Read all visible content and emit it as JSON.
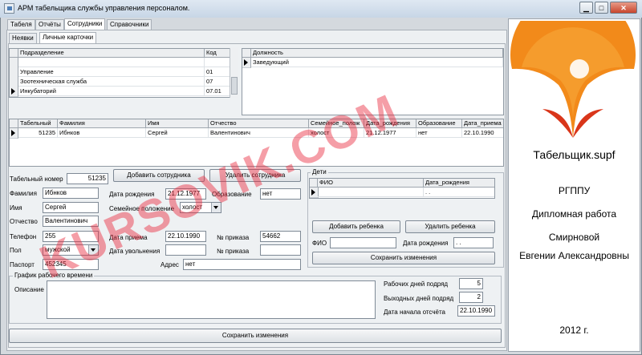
{
  "window": {
    "title": "АРМ табельщика службы управления персоналом.",
    "btn_min": "▁",
    "btn_max": "□",
    "btn_close": "✕"
  },
  "tabs": [
    "Табеля",
    "Отчёты",
    "Сотрудники",
    "Справочники"
  ],
  "subtabs": [
    "Неявки",
    "Личные карточки"
  ],
  "departments": {
    "headers": [
      "Подразделение",
      "Код"
    ],
    "rows": [
      {
        "name": "",
        "code": ""
      },
      {
        "name": "Управление",
        "code": "01"
      },
      {
        "name": "Зоотехническая служба",
        "code": "07"
      },
      {
        "name": "Инкубаторий",
        "code": "07.01"
      }
    ]
  },
  "positions": {
    "header": "Должность",
    "rows": [
      "Заведующий"
    ]
  },
  "employees": {
    "headers": [
      "Табельный",
      "Фамилия",
      "Имя",
      "Отчество",
      "Семейное_полож",
      "Дата_рождения",
      "Образование",
      "Дата_приема"
    ],
    "rows": [
      [
        "51235",
        "Ибнков",
        "Сергей",
        "Валентинович",
        "холост",
        "21.12.1977",
        "нет",
        "22.10.1990"
      ]
    ]
  },
  "form": {
    "tab_number_label": "Табельный номер",
    "tab_number": "51235",
    "add_employee": "Добавить сотрудника",
    "delete_employee": "Удалить сотрудника",
    "surname_label": "Фамилия",
    "surname": "Ибнков",
    "name_label": "Имя",
    "name": "Сергей",
    "patronymic_label": "Отчество",
    "patronymic": "Валентинович",
    "phone_label": "Телефон",
    "phone": "255",
    "gender_label": "Пол",
    "gender": "мужской",
    "passport_label": "Паспорт",
    "passport": "452345",
    "birth_label": "Дата рождения",
    "birth": "21.12.1977",
    "education_label": "Образование",
    "education": "нет",
    "marital_label": "Семейное положение",
    "marital": "холост",
    "hire_label": "Дата приема",
    "hire": "22.10.1990",
    "order_label": "№ приказа",
    "order": "54662",
    "dismiss_label": "Дата увольнения",
    "dismiss": "",
    "order2_label": "№ приказа",
    "order2": "",
    "address_label": "Адрес",
    "address": "нет"
  },
  "children": {
    "title": "Дети",
    "headers": [
      "ФИО",
      "Дата_рождения"
    ],
    "row": [
      "",
      ". ."
    ],
    "add": "Добавить ребенка",
    "delete": "Удалить ребенка",
    "fio_label": "ФИО",
    "fio": "",
    "birth_label": "Дата рождения",
    "birth": ". .",
    "save": "Сохранить изменения"
  },
  "schedule": {
    "title": "График рабочего времени",
    "description_label": "Описание",
    "description": "",
    "workdays_label": "Рабочих дней подряд",
    "workdays": "5",
    "offdays_label": "Выходных дней подряд",
    "offdays": "2",
    "start_label": "Дата начала отсчёта",
    "start": "22.10.1990"
  },
  "save_all": "Сохранить изменения",
  "sidebar": {
    "file": "Табельщик.supf",
    "org": "РГППУ",
    "work": "Дипломная работа",
    "author_surname": "Смирновой",
    "author_name": "Евгении Александровны",
    "year": "2012 г."
  },
  "watermark": "KURSOVIK.COM",
  "colors": {
    "logo_orange": "#f28a1a",
    "logo_red": "#d9361a",
    "watermark": "#e8283c"
  }
}
